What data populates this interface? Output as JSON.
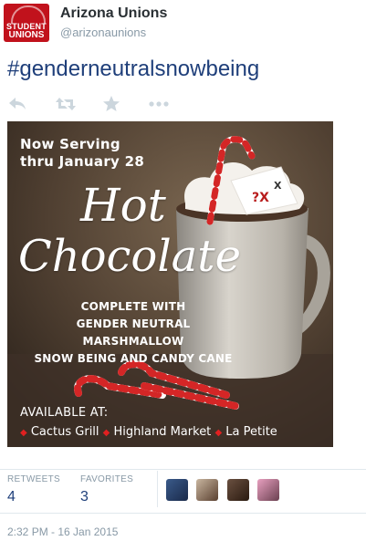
{
  "account": {
    "name": "Arizona Unions",
    "handle": "@arizonaunions",
    "avatar_line1": "STUDENT",
    "avatar_line2": "UNIONS"
  },
  "tweet": {
    "hashtag": "#genderneutralsnowbeing",
    "timestamp": "2:32 PM - 16 Jan 2015"
  },
  "actions": {
    "icons": [
      "reply-icon",
      "retweet-icon",
      "favorite-star-icon",
      "more-dots-icon"
    ]
  },
  "poster": {
    "now_line1": "Now Serving",
    "now_line2": "thru January 28",
    "hot": "Hot",
    "chocolate": "Chocolate",
    "complete_line1": "COMPLETE WITH",
    "complete_line2": "GENDER NEUTRAL MARSHMALLOW",
    "complete_line3": "SNOW BEING AND CANDY CANE",
    "available": "AVAILABLE AT:",
    "location1": "Cactus Grill",
    "location2": "Highland Market",
    "location3": "La Petite"
  },
  "stats": {
    "retweets_label": "RETWEETS",
    "retweets_value": "4",
    "favorites_label": "FAVORITES",
    "favorites_value": "3"
  },
  "colors": {
    "link": "#1f3f7a",
    "muted": "#8899a6",
    "brand_red": "#c1121c"
  }
}
